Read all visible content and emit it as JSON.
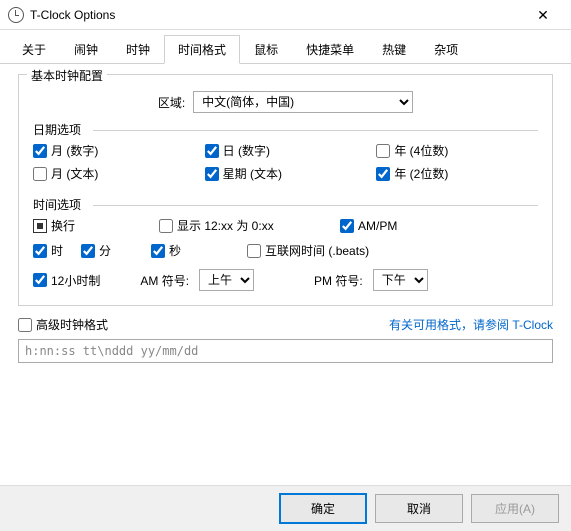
{
  "window": {
    "title": "T-Clock Options"
  },
  "tabs": [
    "关于",
    "闹钟",
    "时钟",
    "时间格式",
    "鼠标",
    "快捷菜单",
    "热键",
    "杂项"
  ],
  "active_tab": 3,
  "group_basic": {
    "label": "基本时钟配置",
    "locale_label": "区域:",
    "locale_value": "中文(简体，中国)",
    "date_section": "日期选项",
    "month_num": "月 (数字)",
    "day_num": "日 (数字)",
    "year4": "年 (4位数)",
    "month_text": "月 (文本)",
    "weekday_text": "星期 (文本)",
    "year2": "年 (2位数)",
    "time_section": "时间选项",
    "linebreak": "换行",
    "show12as0": "显示 12:xx 为 0:xx",
    "ampm": "AM/PM",
    "hour": "时",
    "minute": "分",
    "second": "秒",
    "internet_time": "互联网时间 (.beats)",
    "h12": "12小时制",
    "am_label": "AM 符号:",
    "am_value": "上午",
    "pm_label": "PM 符号:",
    "pm_value": "下午"
  },
  "advanced": {
    "checkbox": "高级时钟格式",
    "link": "有关可用格式，请参阅 T-Clock",
    "format": "h:nn:ss tt\\nddd yy/mm/dd"
  },
  "buttons": {
    "ok": "确定",
    "cancel": "取消",
    "apply": "应用(A)"
  }
}
